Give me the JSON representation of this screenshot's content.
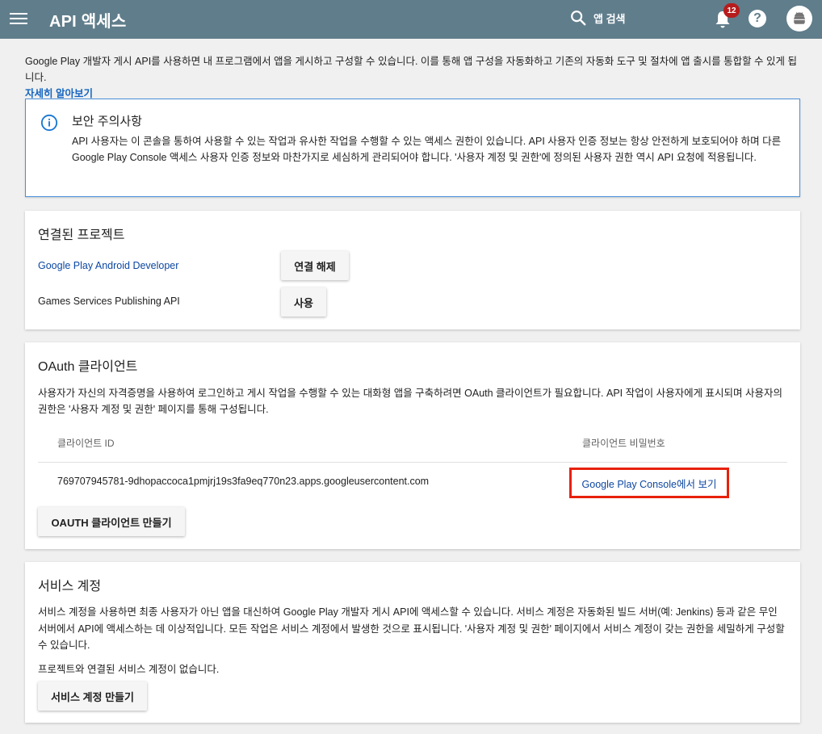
{
  "topbar": {
    "title": "API 액세스",
    "search_label": "앱 검색",
    "notification_count": "12",
    "help_glyph": "?"
  },
  "intro": {
    "text": "Google Play 개발자 게시 API를 사용하면 내 프로그램에서 앱을 게시하고 구성할 수 있습니다. 이를 통해 앱 구성을 자동화하고 기존의 자동화 도구 및 절차에 앱 출시를 통합할 수 있게 됩니다.",
    "learn_more": "자세히 알아보기"
  },
  "notice": {
    "title": "보안 주의사항",
    "body": "API 사용자는 이 콘솔을 통하여 사용할 수 있는 작업과 유사한 작업을 수행할 수 있는 액세스 권한이 있습니다. API 사용자 인증 정보는 항상 안전하게 보호되어야 하며 다른 Google Play Console 액세스 사용자 인증 정보와 마찬가지로 세심하게 관리되어야 합니다. '사용자 계정 및 권한'에 정의된 사용자 권한 역시 API 요청에 적용됩니다."
  },
  "linked_projects": {
    "title": "연결된 프로젝트",
    "projects": [
      {
        "name": "Google Play Android Developer",
        "button": "연결 해제"
      },
      {
        "name": "Games Services Publishing API",
        "button": "사용"
      }
    ]
  },
  "oauth": {
    "title": "OAuth 클라이언트",
    "description": "사용자가 자신의 자격증명을 사용하여 로그인하고 게시 작업을 수행할 수 있는 대화형 앱을 구축하려면 OAuth 클라이언트가 필요합니다. API 작업이 사용자에게 표시되며 사용자의 권한은 '사용자 계정 및 권한' 페이지를 통해 구성됩니다.",
    "col_client_id": "클라이언트 ID",
    "col_client_secret": "클라이언트 비밀번호",
    "client_id": "769707945781-9dhopaccoca1pmjrj19s3fa9eq770n23.apps.googleusercontent.com",
    "secret_link": "Google Play Console에서 보기",
    "create_button": "OAUTH 클라이언트 만들기"
  },
  "service_accounts": {
    "title": "서비스 계정",
    "description": "서비스 계정을 사용하면 최종 사용자가 아닌 앱을 대신하여 Google Play 개발자 게시 API에 액세스할 수 있습니다. 서비스 계정은 자동화된 빌드 서버(예: Jenkins) 등과 같은 무인 서버에서 API에 액세스하는 데 이상적입니다. 모든 작업은 서비스 계정에서 발생한 것으로 표시됩니다. '사용자 계정 및 권한' 페이지에서 서비스 계정이 갖는 권한을 세밀하게 구성할 수 있습니다.",
    "empty_text": "프로젝트와 연결된 서비스 계정이 없습니다.",
    "create_button": "서비스 계정 만들기"
  },
  "colors": {
    "appbar": "#607d8b",
    "link": "#0d47a1",
    "highlight": "#e8210b",
    "badge": "#b71c1c"
  },
  "icons": [
    "menu-icon",
    "search-icon",
    "bell-icon",
    "help-icon",
    "avatar-icon",
    "info-icon"
  ]
}
